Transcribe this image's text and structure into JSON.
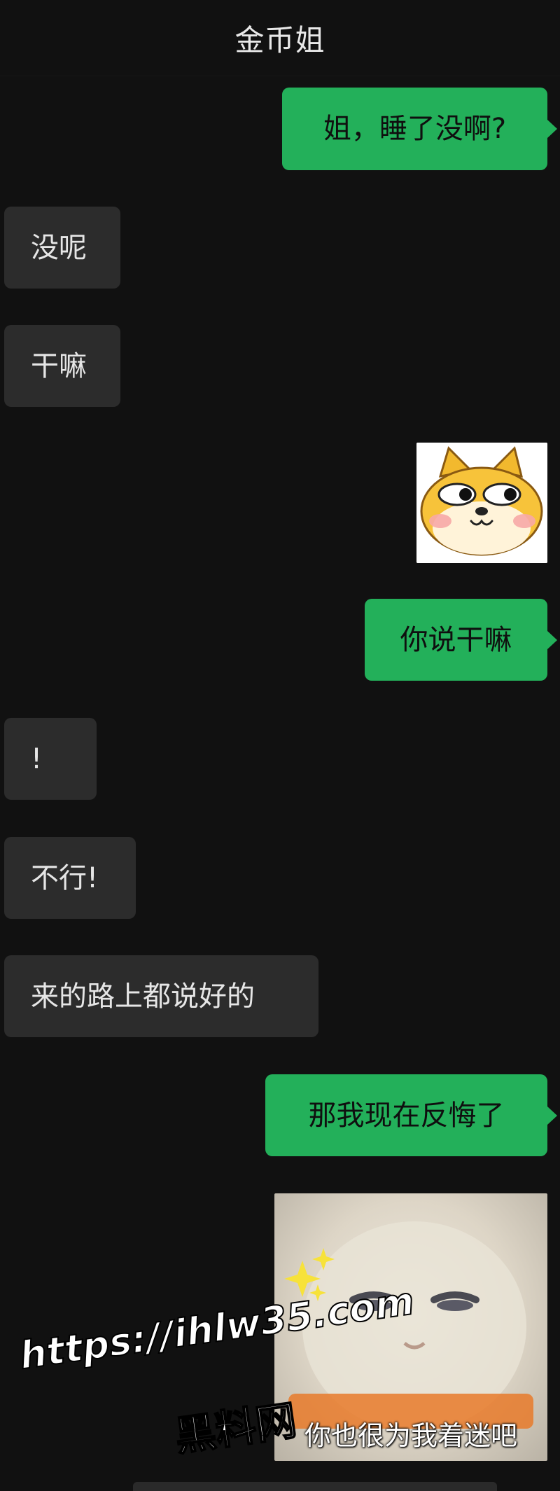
{
  "header": {
    "title": "金币姐"
  },
  "messages": [
    {
      "side": "out",
      "text": "姐，睡了没啊?"
    },
    {
      "side": "in",
      "text": "没呢"
    },
    {
      "side": "in",
      "text": "干嘛"
    },
    {
      "side": "out",
      "sticker": "shiba-dog-side-eye"
    },
    {
      "side": "out",
      "text": "你说干嘛"
    },
    {
      "side": "in",
      "text": "!"
    },
    {
      "side": "in",
      "text": "不行!"
    },
    {
      "side": "in",
      "text": "来的路上都说好的"
    },
    {
      "side": "out",
      "text": "那我现在反悔了"
    },
    {
      "side": "out",
      "sticker": "cat-meme",
      "caption": "你也很为我着迷吧"
    }
  ],
  "watermark": {
    "line1": "https://ihlw35.com",
    "line2": "黑料网"
  },
  "colors": {
    "background": "#111111",
    "outgoing_bubble": "#23b05a",
    "incoming_bubble": "#2c2c2c"
  }
}
